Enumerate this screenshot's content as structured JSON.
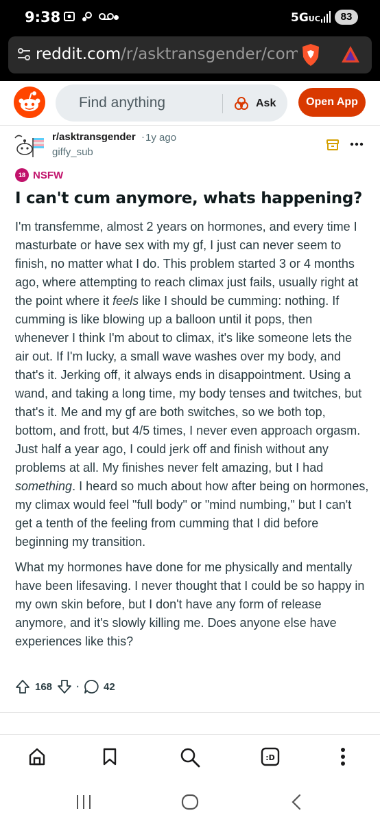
{
  "status_bar": {
    "time": "9:38",
    "network": "5G",
    "network_sub": "UC",
    "battery": "83"
  },
  "browser": {
    "url_domain": "reddit.com",
    "url_path": "/r/asktransgender/comm"
  },
  "header": {
    "search_placeholder": "Find anything",
    "ask_label": "Ask",
    "open_app_label": "Open App"
  },
  "post": {
    "subreddit": "r/asktransgender",
    "separator": "·",
    "age": "1y ago",
    "author": "giffy_sub",
    "nsfw_badge": "18",
    "nsfw_label": "NSFW",
    "title": "I can't cum anymore, whats happening?",
    "p1_a": "I'm transfemme, almost 2 years on hormones, and every time I masturbate or have sex with my gf, I just can never seem to finish, no matter what I do. This problem started 3 or 4 months ago, where attempting to reach climax just fails, usually right at the point where it ",
    "p1_em1": "feels",
    "p1_b": " like I should be cumming: nothing. If cumming is like blowing up a balloon until it pops, then whenever I think I'm about to climax, it's like someone lets the air out. If I'm lucky, a small wave washes over my body, and that's it. Jerking off, it always ends in disappointment. Using a wand, and taking a long time, my body tenses and twitches, but that's it. Me and my gf are both switches, so we both top, bottom, and frott, but 4/5 times, I never even approach orgasm. Just half a year ago, I could jerk off and finish without any problems at all. My finishes never felt amazing, but I had ",
    "p1_em2": "something",
    "p1_c": ". I heard so much about how after being on hormones, my climax would feel \"full body\" or \"mind numbing,\" but I can't get a tenth of the feeling from cumming that I did before beginning my transition.",
    "p2": "What my hormones have done for me physically and mentally have been lifesaving. I never thought that I could be so happy in my own skin before, but I don't have any form of release anymore, and it's slowly killing me. Does anyone else have experiences like this?",
    "upvotes": "168",
    "vote_sep": "·",
    "comments": "42"
  },
  "colors": {
    "reddit_orange": "#d93900",
    "nsfw_pink": "#c1126b",
    "text": "#1a1a1b",
    "muted": "#576f76"
  },
  "icons": {
    "nav": [
      "home-icon",
      "bookmark-icon",
      "search-icon",
      "chat-icon",
      "more-icon"
    ],
    "system": [
      "recents-icon",
      "home-button-icon",
      "back-icon"
    ]
  }
}
